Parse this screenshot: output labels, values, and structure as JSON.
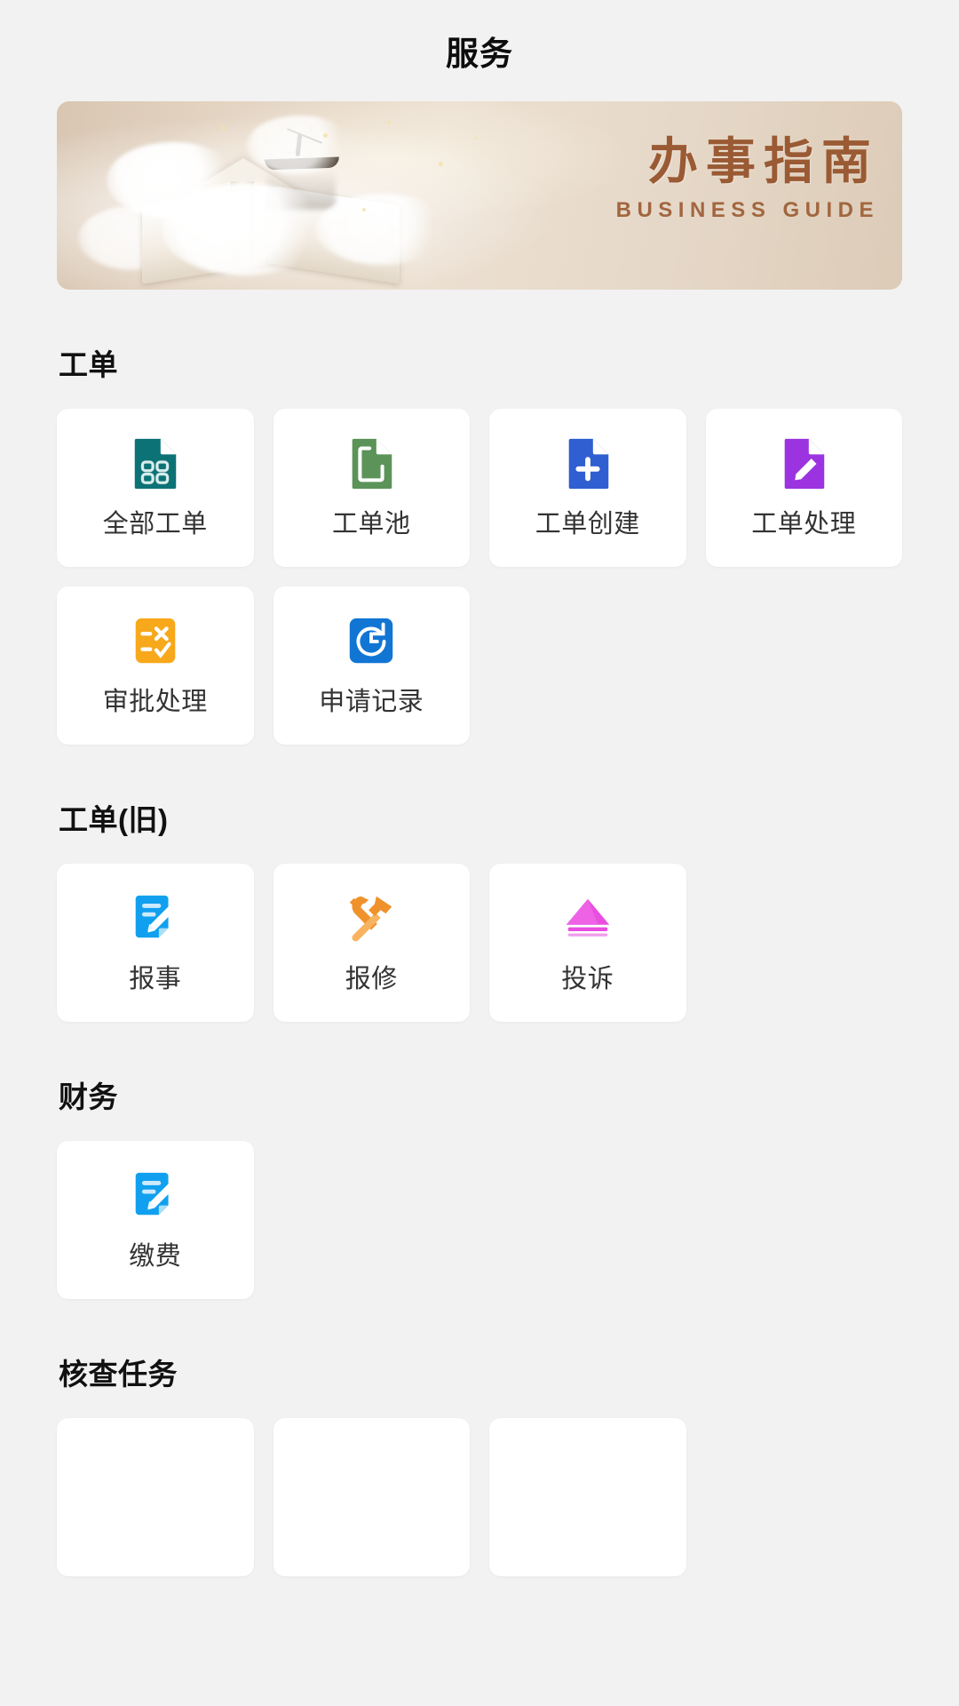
{
  "header": {
    "title": "服务"
  },
  "banner": {
    "title_cn": "办事指南",
    "title_en": "BUSINESS GUIDE",
    "accent_color": "#9a5a33",
    "background_color": "#e3d3c1",
    "icon": "book-illustration"
  },
  "sections": [
    {
      "title": "工单",
      "items": [
        {
          "label": "全部工单",
          "icon": "document-grid-icon",
          "color": "#0d7276"
        },
        {
          "label": "工单池",
          "icon": "document-pool-icon",
          "color": "#5b9358"
        },
        {
          "label": "工单创建",
          "icon": "document-plus-icon",
          "color": "#2f5fd0"
        },
        {
          "label": "工单处理",
          "icon": "document-edit-icon",
          "color": "#9b34e0"
        },
        {
          "label": "审批处理",
          "icon": "checklist-approve-icon",
          "color": "#f7a81b"
        },
        {
          "label": "申请记录",
          "icon": "history-clock-icon",
          "color": "#1175d4"
        }
      ]
    },
    {
      "title": "工单(旧)",
      "items": [
        {
          "label": "报事",
          "icon": "note-pencil-icon",
          "color": "#11a0ef"
        },
        {
          "label": "报修",
          "icon": "wrench-hammer-icon",
          "color": "#f5a03c"
        },
        {
          "label": "投诉",
          "icon": "complaint-icon",
          "color": "#e84fe0"
        }
      ]
    },
    {
      "title": "财务",
      "items": [
        {
          "label": "缴费",
          "icon": "note-pencil-icon",
          "color": "#11a0ef"
        }
      ]
    },
    {
      "title": "核查任务",
      "items": [
        {
          "label": "",
          "icon": "",
          "color": "#ffffff"
        },
        {
          "label": "",
          "icon": "",
          "color": "#ffffff"
        },
        {
          "label": "",
          "icon": "",
          "color": "#ffffff"
        }
      ]
    }
  ]
}
